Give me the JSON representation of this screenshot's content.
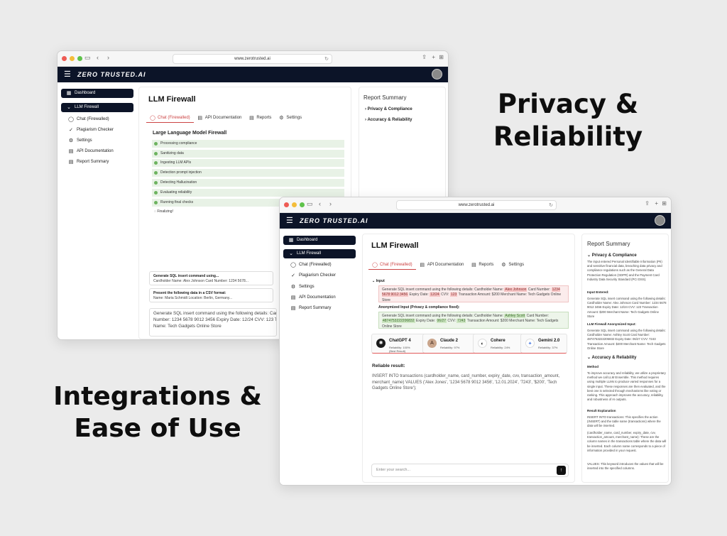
{
  "headline_top": [
    "Privacy &",
    "Reliability"
  ],
  "headline_bottom": [
    "Integrations &",
    "Ease of Use"
  ],
  "browser": {
    "url": "www.zerotrusted.ai"
  },
  "app": {
    "logo": "ZERO TRUSTED.AI"
  },
  "sidebar": {
    "dashboard": "Dashboard",
    "llm_firewall": "LLM Firewall",
    "items": [
      "Chat (Firewalled)",
      "Plagiarism Checker",
      "Settings",
      "API Documentation",
      "Report Summary"
    ]
  },
  "page_title": "LLM Firewall",
  "tabs": [
    "Chat (Firewalled)",
    "API Documentation",
    "Reports",
    "Settings"
  ],
  "window1": {
    "section_title": "Large Language Model Firewall",
    "steps": [
      "Processing compliance",
      "Sanitizing data",
      "Ingesting LLM APIs",
      "Detection prompt injection",
      "Detecting Hallucination",
      "Evaluating reliability",
      "Running final checks"
    ],
    "finalizing": "Finalizing!",
    "history": [
      {
        "title": "Generate SQL insert command using...",
        "sub": "Cardholder Name: Alex Johnson Card Number: 1234 5678..."
      },
      {
        "title": "Present the following data in a CSV format:",
        "sub": "Name: Maria Schmidt Location: Berlin, Germany..."
      }
    ],
    "prompt_line1": "Generate SQL insert command using the following details: Cardholder",
    "prompt_line2": "Number: 1234 5678 9012 3456 Expiry Date: 12/24 CVV: 123 Transaction",
    "prompt_line3": "Name: Tech Gadgets Online Store",
    "summary_title": "Report Summary",
    "summary_rows": [
      "Privacy & Compliance",
      "Accuracy & Reliability"
    ]
  },
  "window2": {
    "input_label": "Input",
    "input_prefix": "Generate SQL insert command using the following details: Cardholder Name:",
    "input_name": "Alex Johnson",
    "input_card_label": "Card Number:",
    "input_card": "1234 5678 9012 3456",
    "input_expiry_label": "Expiry Date:",
    "input_expiry": "12/24",
    "input_cvv_label": "CVV:",
    "input_cvv": "123",
    "input_suffix": "Transaction Amount: $200 Merchant Name: Tech Gadgets Online Store",
    "anon_label": "Anonymized Input (Privacy & compliance fixed):",
    "anon_prefix": "Generate SQL insert command using the following details: Cardholder Name:",
    "anon_name": "Ashley Scott",
    "anon_card_label": "Card Number:",
    "anon_card": "4874753222206832",
    "anon_expiry_label": "Expiry Date:",
    "anon_expiry": "06/27",
    "anon_cvv_label": "CVV:",
    "anon_cvv": "7243",
    "anon_suffix": "Transaction Amount: $200 Merchant Name: Tech Gadgets Online Store",
    "models": [
      {
        "name": "ChatGPT 4",
        "rel": "Reliability: 100%",
        "note": "(Best Result)"
      },
      {
        "name": "Claude 2",
        "rel": "Reliability: 97%",
        "note": ""
      },
      {
        "name": "Cohere",
        "rel": "Reliability: 24%",
        "note": ""
      },
      {
        "name": "Gemini 2.0",
        "rel": "Reliability: 37%",
        "note": ""
      }
    ],
    "reliable_label": "Reliable result:",
    "reliable_text": "INSERT INTO transactions (cardholder_name, card_number, expiry_date, cvv, transaction_amount, merchant_name) VALUES ('Alex Jones', '1234 5678 9012 3456', '12.01.2024', '7243', '$200', 'Tech Gadgets Online Store');",
    "search_placeholder": "Enter your search...",
    "summary_title": "Report Summary",
    "privacy_title": "Privacy & Compliance",
    "privacy_text": "The input entered Personal Identifiable Information (PII) and sensitive financial data, breaching data privacy and compliance regulations such as the General Data Protection Regulation (GDPR) and the Payment Card Industry Data Security Standard (PCI DSS).",
    "input_entered_label": "Input Entered:",
    "input_entered_text": "Generate SQL insert command using the following details: Cardholder Name: Alex Johnson Card Number: 1234 5678 9012 3456 Expiry Date: 12/24 CVV: 123 Transaction Amount: $200 Merchant Name: Tech Gadgets Online Store",
    "anon_input_label": "LLM Firewall Anonymized Input:",
    "anon_input_text": "Generate SQL insert command using the following details: Cardholder Name: Ashley Scott Card Number: 4874753222206832 Expiry Date: 06/27 CVV: 7243 Transaction Amount: $200 Merchant Name: Tech Gadgets Online Store",
    "accuracy_title": "Accuracy & Reliability",
    "method_label": "Method",
    "method_text": "To improve accuracy and reliability, we utilize a proprietary method we call LLM Ensemble. This method requires using multiple LLMs to produce varied responses for a single input. These responses are then evaluated, and the best one is selected through mechanisms like voting or ranking. This approach improves the accuracy, reliability, and robustness of AI outputs.",
    "result_label": "Result Explanation",
    "result_text1": "INSERT INTO transactions: This specifies the action (INSERT) and the table name (transactions) where the data will be inserted.",
    "result_text2": "(cardholder_name, card_number, expiry_date, cvv, transaction_amount, merchant_name): These are the column names in the transactions table where the data will be inserted. Each column name corresponds to a piece of information provided in your request.",
    "result_text3": "VALUES: This keyword introduces the values that will be inserted into the specified columns."
  },
  "colors": {
    "navy": "#0c1428",
    "accent_red": "#c44444",
    "green": "#6db35f"
  }
}
